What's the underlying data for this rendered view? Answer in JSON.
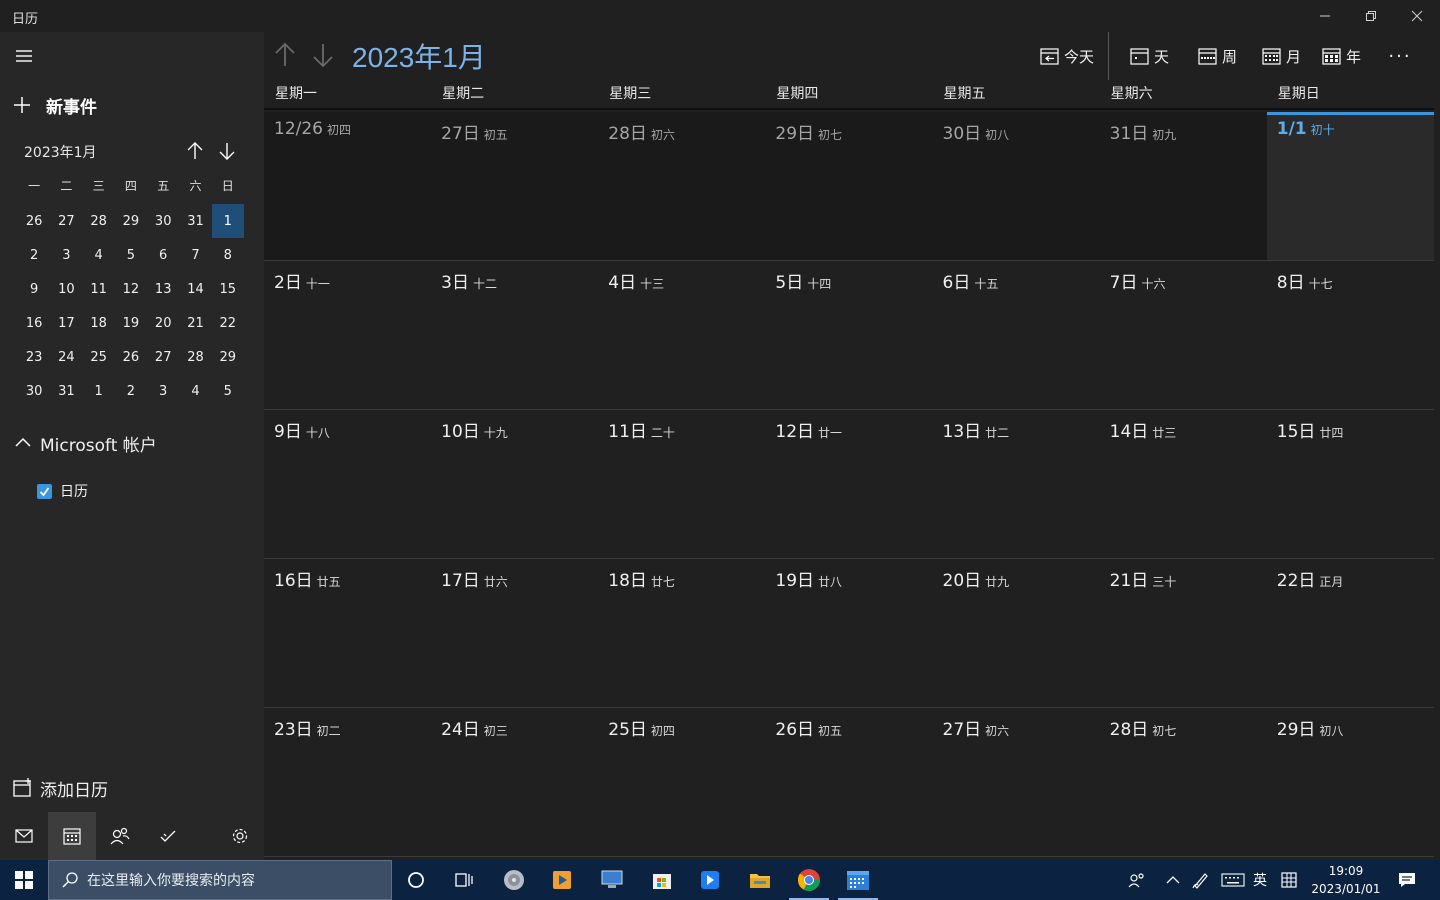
{
  "window": {
    "title": "日历"
  },
  "sidebar": {
    "new_event": "新事件",
    "mini_calendar": {
      "title": "2023年1月",
      "weekdays": [
        "一",
        "二",
        "三",
        "四",
        "五",
        "六",
        "日"
      ],
      "weeks": [
        [
          "26",
          "27",
          "28",
          "29",
          "30",
          "31",
          "1"
        ],
        [
          "2",
          "3",
          "4",
          "5",
          "6",
          "7",
          "8"
        ],
        [
          "9",
          "10",
          "11",
          "12",
          "13",
          "14",
          "15"
        ],
        [
          "16",
          "17",
          "18",
          "19",
          "20",
          "21",
          "22"
        ],
        [
          "23",
          "24",
          "25",
          "26",
          "27",
          "28",
          "29"
        ],
        [
          "30",
          "31",
          "1",
          "2",
          "3",
          "4",
          "5"
        ]
      ],
      "selected": "1"
    },
    "account": "Microsoft 帐户",
    "calendar_name": "日历",
    "add_calendar": "添加日历"
  },
  "header": {
    "month_title": "2023年1月",
    "today": "今天",
    "day": "天",
    "week": "周",
    "month": "月",
    "year": "年",
    "more": "···"
  },
  "month_view": {
    "weekdays": [
      "星期一",
      "星期二",
      "星期三",
      "星期四",
      "星期五",
      "星期六",
      "星期日"
    ],
    "weeks": [
      [
        {
          "day": "12/26",
          "lunar": "初四",
          "other": true
        },
        {
          "day": "27日",
          "lunar": "初五",
          "other": true
        },
        {
          "day": "28日",
          "lunar": "初六",
          "other": true
        },
        {
          "day": "29日",
          "lunar": "初七",
          "other": true
        },
        {
          "day": "30日",
          "lunar": "初八",
          "other": true
        },
        {
          "day": "31日",
          "lunar": "初九",
          "other": true
        },
        {
          "day": "1/1",
          "lunar": "初十",
          "today": true
        }
      ],
      [
        {
          "day": "2日",
          "lunar": "十一"
        },
        {
          "day": "3日",
          "lunar": "十二"
        },
        {
          "day": "4日",
          "lunar": "十三"
        },
        {
          "day": "5日",
          "lunar": "十四"
        },
        {
          "day": "6日",
          "lunar": "十五"
        },
        {
          "day": "7日",
          "lunar": "十六"
        },
        {
          "day": "8日",
          "lunar": "十七"
        }
      ],
      [
        {
          "day": "9日",
          "lunar": "十八"
        },
        {
          "day": "10日",
          "lunar": "十九"
        },
        {
          "day": "11日",
          "lunar": "二十"
        },
        {
          "day": "12日",
          "lunar": "廿一"
        },
        {
          "day": "13日",
          "lunar": "廿二"
        },
        {
          "day": "14日",
          "lunar": "廿三"
        },
        {
          "day": "15日",
          "lunar": "廿四"
        }
      ],
      [
        {
          "day": "16日",
          "lunar": "廿五"
        },
        {
          "day": "17日",
          "lunar": "廿六"
        },
        {
          "day": "18日",
          "lunar": "廿七"
        },
        {
          "day": "19日",
          "lunar": "廿八"
        },
        {
          "day": "20日",
          "lunar": "廿九"
        },
        {
          "day": "21日",
          "lunar": "三十"
        },
        {
          "day": "22日",
          "lunar": "正月"
        }
      ],
      [
        {
          "day": "23日",
          "lunar": "初二"
        },
        {
          "day": "24日",
          "lunar": "初三"
        },
        {
          "day": "25日",
          "lunar": "初四"
        },
        {
          "day": "26日",
          "lunar": "初五"
        },
        {
          "day": "27日",
          "lunar": "初六"
        },
        {
          "day": "28日",
          "lunar": "初七"
        },
        {
          "day": "29日",
          "lunar": "初八"
        }
      ]
    ]
  },
  "taskbar": {
    "search_placeholder": "在这里输入你要搜索的内容",
    "ime": "英",
    "time": "19:09",
    "date": "2023/01/01"
  },
  "colors": {
    "accent": "#3a96dd",
    "title_blue": "#7ab4ea",
    "taskbar": "#0b2340"
  }
}
